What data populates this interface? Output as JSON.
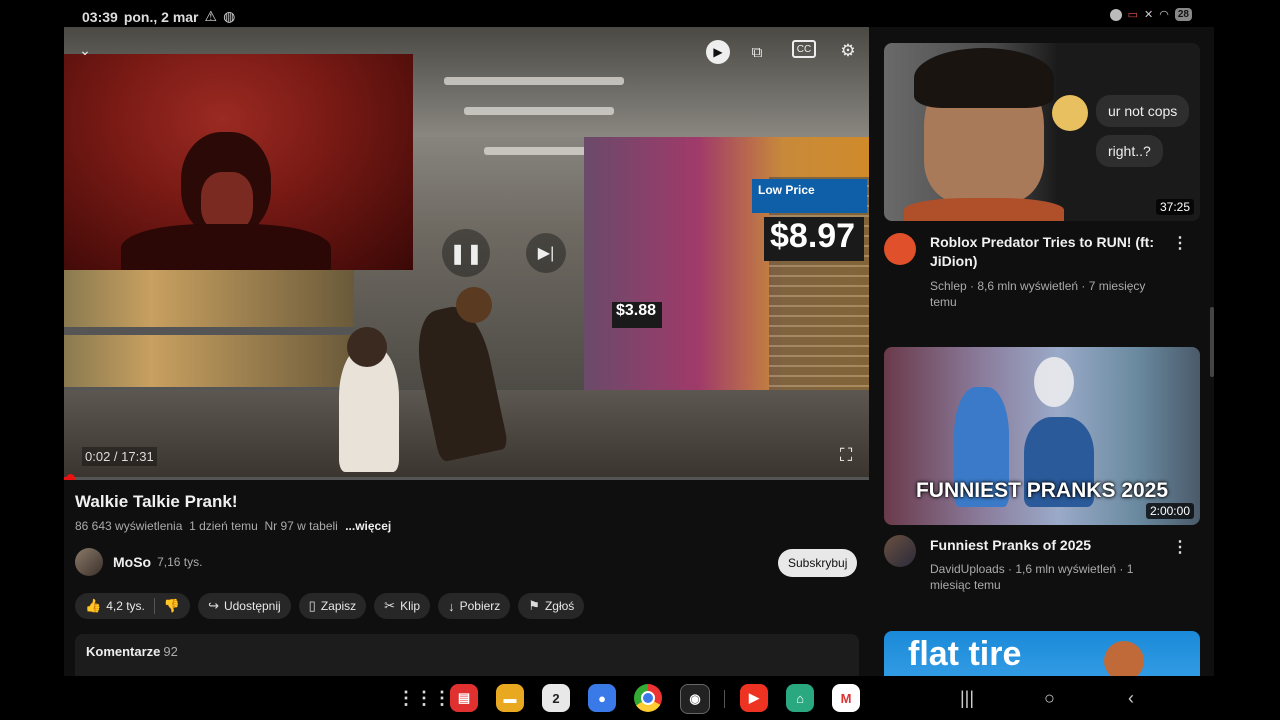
{
  "status_bar": {
    "time": "03:39",
    "date": "pon., 2 mar",
    "battery": "28"
  },
  "player": {
    "time_label": "0:02 / 17:31",
    "progress": 0.002,
    "store_price_1": "$8.97",
    "store_price_1_header": "Low Price",
    "store_price_2": "$3.88"
  },
  "video": {
    "title": "Walkie Talkie Prank!",
    "views": "86 643 wyświetlenia",
    "age": "1 dzień temu",
    "rank": "Nr 97 w tabeli",
    "more": "...więcej",
    "channel_name": "MoSo",
    "channel_subs": "7,16 tys.",
    "subscribe_label": "Subskrybuj",
    "likes": "4,2 tys.",
    "share": "Udostępnij",
    "save": "Zapisz",
    "clip": "Klip",
    "download": "Pobierz",
    "report": "Zgłoś",
    "comments_label": "Komentarze",
    "comments_count": "92"
  },
  "recommendations": [
    {
      "title": "Roblox Predator Tries to RUN! (ft: JiDion)",
      "meta": "Schlep · 8,6 mln wyświetleń · 7 miesięcy temu",
      "duration": "37:25",
      "bubble_1": "ur not cops",
      "bubble_2": "right..?"
    },
    {
      "title": "Funniest Pranks of 2025",
      "meta": "DavidUploads · 1,6 mln wyświetleń · 1 miesiąc temu",
      "duration": "2:00:00",
      "overlay_text": "FUNNIEST PRANKS 2025"
    },
    {
      "overlay_text": "flat tire"
    }
  ],
  "taskbar": {
    "calendar_day": "2"
  },
  "colors": {
    "accent": "#e11d1d",
    "background": "#0f0f0f",
    "pill": "#272727"
  }
}
